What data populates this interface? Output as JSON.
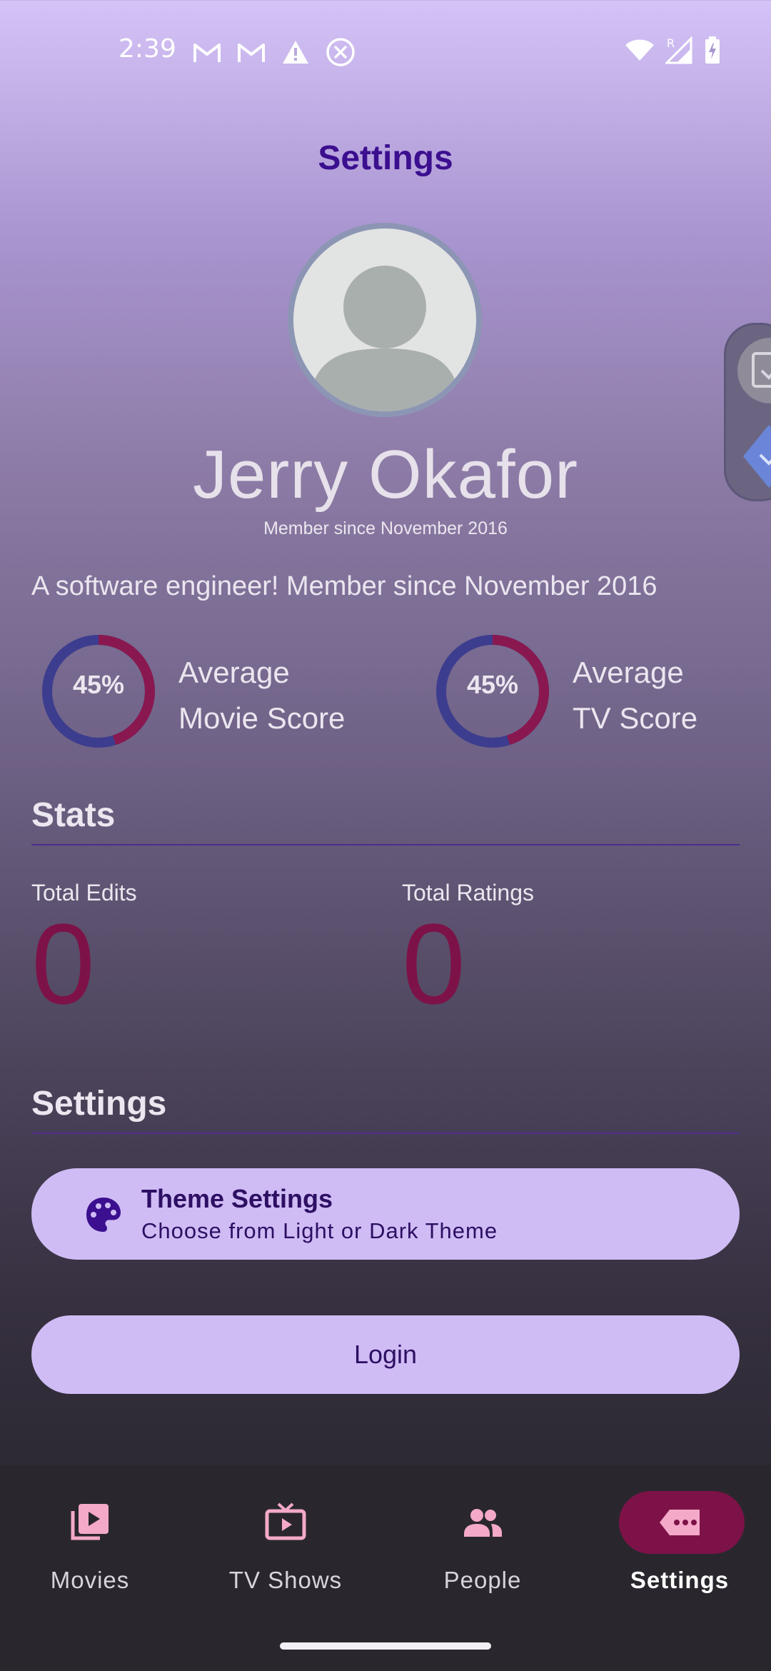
{
  "status_bar": {
    "time": "2:39",
    "left_icons": [
      "gmail-icon",
      "gmail-icon",
      "warning-icon",
      "cancel-circle-icon"
    ],
    "right_icons": [
      "wifi-icon",
      "signal-roaming-icon",
      "battery-charging-icon"
    ]
  },
  "header": {
    "title": "Settings"
  },
  "profile": {
    "avatar_icon": "person-avatar-icon",
    "name": "Jerry Okafor",
    "member_since": "Member since November 2016",
    "bio": "A software engineer! Member since November 2016"
  },
  "scores": [
    {
      "percent": 45,
      "percent_label": "45%",
      "line1": "Average",
      "line2": "Movie Score"
    },
    {
      "percent": 45,
      "percent_label": "45%",
      "line1": "Average",
      "line2": "TV Score"
    }
  ],
  "stats": {
    "title": "Stats",
    "total_edits_label": "Total Edits",
    "total_edits_value": "0",
    "total_ratings_label": "Total Ratings",
    "total_ratings_value": "0"
  },
  "settings": {
    "title": "Settings",
    "theme": {
      "icon": "palette-icon",
      "title": "Theme Settings",
      "subtitle": "Choose from Light or Dark Theme"
    },
    "login_label": "Login"
  },
  "bottom_nav": {
    "items": [
      {
        "label": "Movies",
        "icon": "movie-library-icon",
        "active": false
      },
      {
        "label": "TV Shows",
        "icon": "tv-icon",
        "active": false
      },
      {
        "label": "People",
        "icon": "people-icon",
        "active": false
      },
      {
        "label": "Settings",
        "icon": "settings-label-icon",
        "active": true
      }
    ]
  },
  "colors": {
    "accent": "#7d1248",
    "ring_primary": "#3d3d8f",
    "ring_secondary": "#8a1850",
    "card_background": "#cfbcf5",
    "title": "#3b0f8f"
  }
}
